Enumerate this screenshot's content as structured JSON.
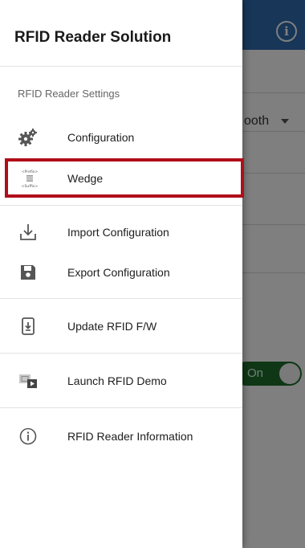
{
  "background": {
    "dropdown_text": "ooth",
    "toggle_label": "On",
    "info_icon": "info-icon"
  },
  "drawer": {
    "title": "RFID Reader Solution",
    "section_label": "RFID Reader Settings",
    "items": [
      {
        "label": "Configuration",
        "icon": "gears-icon"
      },
      {
        "label": "Wedge",
        "icon": "wedge-icon"
      },
      {
        "label": "Import Configuration",
        "icon": "import-icon"
      },
      {
        "label": "Export Configuration",
        "icon": "save-icon"
      },
      {
        "label": "Update RFID F/W",
        "icon": "firmware-update-icon"
      },
      {
        "label": "Launch RFID Demo",
        "icon": "demo-icon"
      },
      {
        "label": "RFID Reader Information",
        "icon": "info-circle-icon"
      }
    ],
    "wedge_icon_text": {
      "prefix": "<Prefix>",
      "suffix": "<Suffix>"
    }
  },
  "colors": {
    "app_bar": "#2f6db0",
    "highlight": "#b00e19",
    "toggle": "#1f6e2c"
  }
}
